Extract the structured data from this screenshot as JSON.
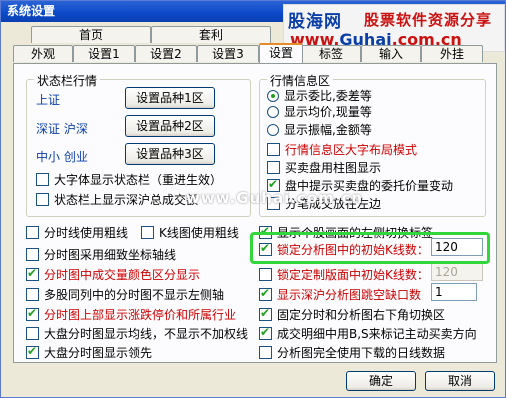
{
  "window": {
    "title": "系统设置"
  },
  "brand": {
    "name_a": "股海网",
    "name_b": "股票软件资源分享",
    "url_a": "www.",
    "url_b": "Guhai",
    "url_c": ".com.cn"
  },
  "tabs_top": [
    "首页",
    "套利",
    "标签",
    "输入",
    "外挂"
  ],
  "tabs_bottom": [
    "外观",
    "设置1",
    "设置2",
    "设置3",
    "设置"
  ],
  "status_group": {
    "title": "状态栏行情",
    "rows": [
      {
        "label": "上证",
        "button": "设置品种1区"
      },
      {
        "label": "深证 沪深",
        "button": "设置品种2区"
      },
      {
        "label": "中小 创业",
        "button": "设置品种3区"
      }
    ],
    "check1": "大字体显示状态栏（重进生效）",
    "check2": "状态栏上显示深沪总成交额"
  },
  "quote_group": {
    "title": "行情信息区",
    "radios": [
      "显示委比,委差等",
      "显示均价,现量等",
      "显示振幅,金额等"
    ],
    "checks": [
      {
        "label": "行情信息区大字布局模式",
        "checked": false,
        "red": true
      },
      {
        "label": "买卖盘用柱图显示",
        "checked": false,
        "red": false
      },
      {
        "label": "盘中提示买卖盘的委托价量变动",
        "checked": true,
        "red": false
      },
      {
        "label": "分笔成交放在左边",
        "checked": false,
        "red": false
      }
    ]
  },
  "watermark": "www.Guhai.com.cn",
  "left_checks": [
    {
      "label": "分时线使用粗线",
      "checked": false,
      "red": false
    },
    {
      "label": "分时图采用细致坐标轴线",
      "checked": false,
      "red": false
    },
    {
      "label": "分时图中成交量颜色区分显示",
      "checked": true,
      "red": true
    },
    {
      "label": "多股同列中的分时图不显示左侧轴",
      "checked": false,
      "red": false
    },
    {
      "label": "分时图上部显示涨跌停价和所属行业",
      "checked": true,
      "red": true
    },
    {
      "label": "大盘分时图显示均线，不显示不加权线",
      "checked": false,
      "red": false
    },
    {
      "label": "大盘分时图显示领先",
      "checked": true,
      "red": false
    }
  ],
  "kline_check": {
    "label": "K线图使用粗线",
    "checked": false
  },
  "right_checks": [
    {
      "label": "显示个股画面的左侧切换标签",
      "checked": true,
      "red": false,
      "value": null
    },
    {
      "label": "锁定分析图中的初始K线数：",
      "checked": true,
      "red": true,
      "value": "120"
    },
    {
      "label": "锁定定制版面中初始K线数：",
      "checked": false,
      "red": true,
      "value": "120"
    },
    {
      "label": "显示深沪分析图跳空缺口数",
      "checked": true,
      "red": true,
      "value": "1"
    },
    {
      "label": "固定分时和分析图右下角切换区",
      "checked": true,
      "red": false,
      "value": null
    },
    {
      "label": "成交明细中用B,S来标记主动买卖方向",
      "checked": true,
      "red": false,
      "value": null
    },
    {
      "label": "分析图完全使用下载的日线数据",
      "checked": false,
      "red": false,
      "value": null
    }
  ],
  "buttons": {
    "ok": "确定",
    "cancel": "取消"
  }
}
